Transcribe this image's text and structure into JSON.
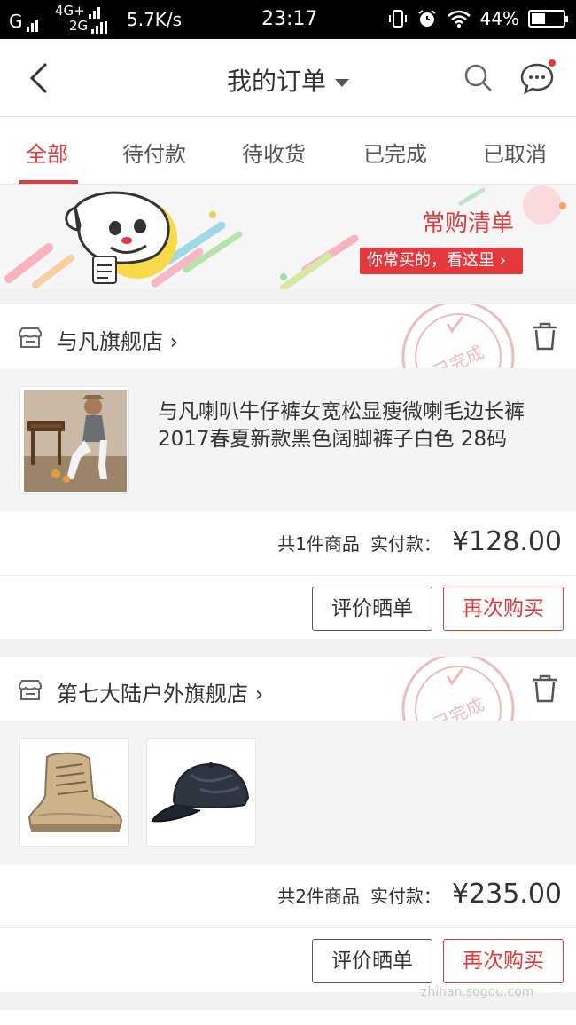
{
  "status_bar": {
    "carrier1": "G",
    "net_top": "4G+",
    "net_bottom": "2G",
    "speed": "5.7K/s",
    "time": "23:17",
    "battery": "44%",
    "battery_level": 0.44
  },
  "header": {
    "title": "我的订单"
  },
  "tabs": [
    {
      "label": "全部"
    },
    {
      "label": "待付款"
    },
    {
      "label": "待收货"
    },
    {
      "label": "已完成"
    },
    {
      "label": "已取消"
    }
  ],
  "banner": {
    "title": "常购清单",
    "subtitle": "你常买的，看这里"
  },
  "orders": [
    {
      "shop": "与凡旗舰店",
      "stamp": "已完成",
      "product_title": "与凡喇叭牛仔裤女宽松显瘦微喇毛边长裤2017春夏新款黑色阔脚裤子白色 28码",
      "count_text": "共1件商品",
      "paid_label": "实付款：",
      "price": "¥128.00",
      "review_button": "评价晒单",
      "rebuy_button": "再次购买"
    },
    {
      "shop": "第七大陆户外旗舰店",
      "stamp": "已完成",
      "count_text": "共2件商品",
      "paid_label": "实付款：",
      "price": "¥235.00",
      "review_button": "评价晒单",
      "rebuy_button": "再次购买"
    }
  ],
  "watermark": "zhihan.sogou.com",
  "colors": {
    "accent": "#e4393c",
    "stamp": "#e8a0a0"
  }
}
